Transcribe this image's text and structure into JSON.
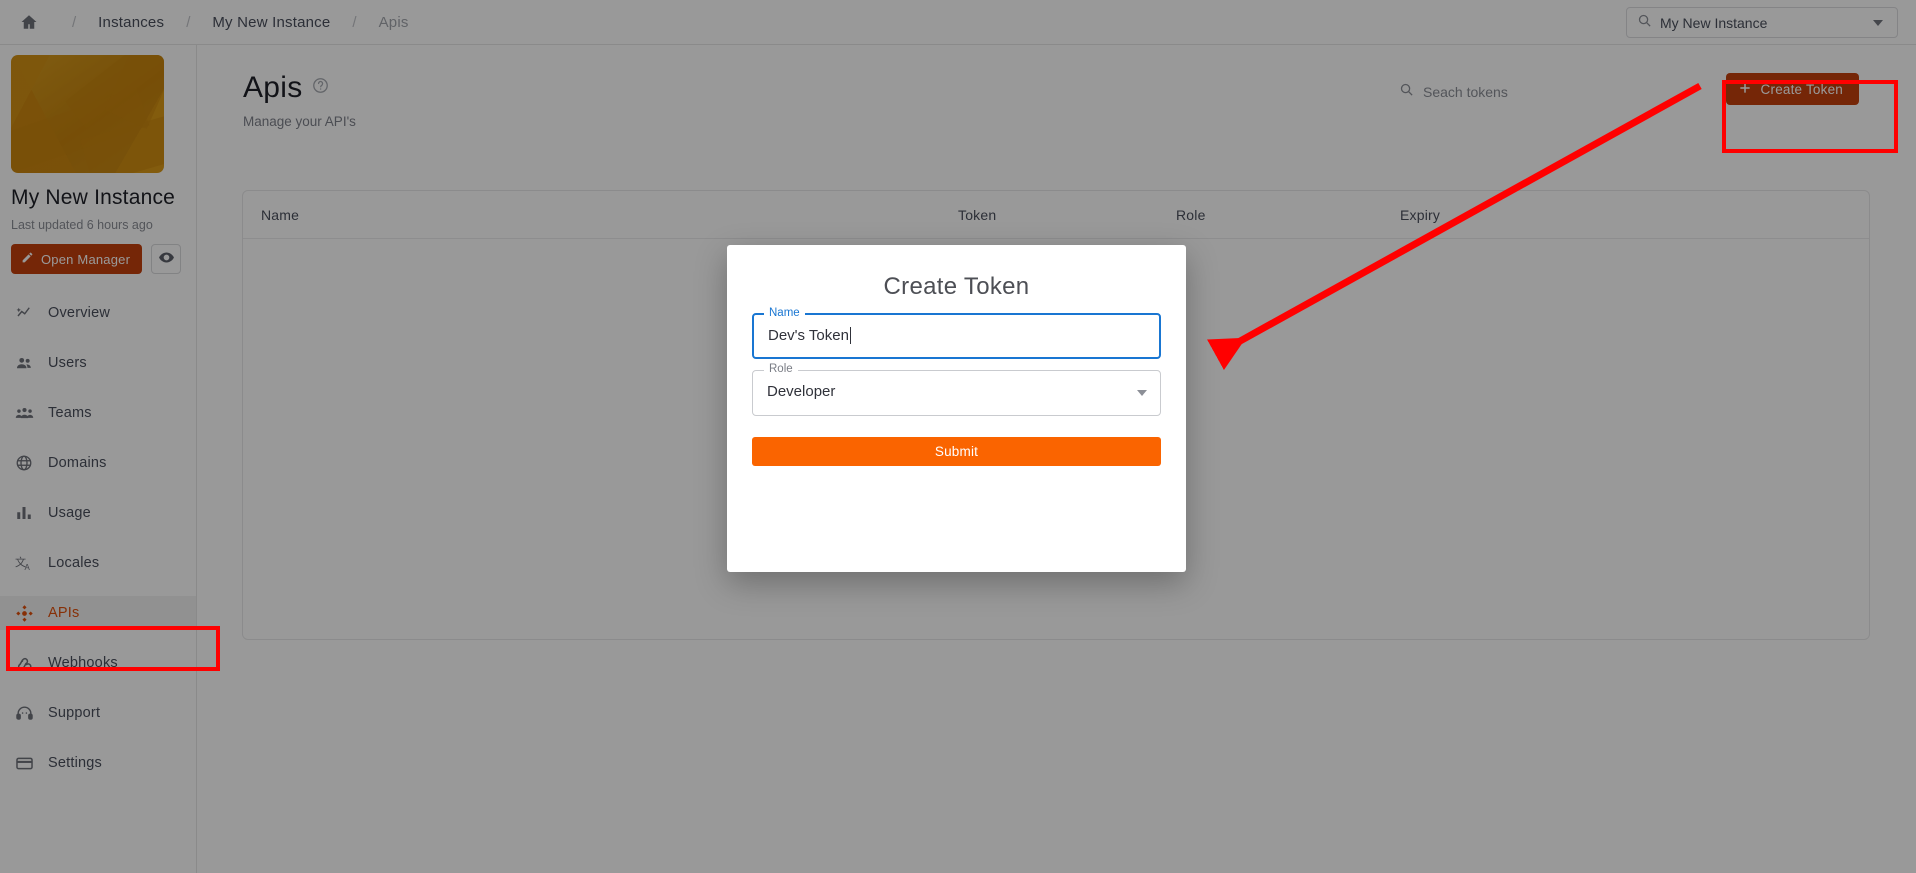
{
  "topbar": {
    "home_icon": "home-icon",
    "breadcrumbs": [
      {
        "label": "Instances",
        "muted": false
      },
      {
        "label": "My New Instance",
        "muted": false
      },
      {
        "label": "Apis",
        "muted": true
      }
    ],
    "separator": "/",
    "instance_select": {
      "icon": "search-icon",
      "value": "My New Instance",
      "caret": "chevron-down-icon"
    }
  },
  "sidebar": {
    "instance": {
      "thumbnail_alt": "instance-thumbnail",
      "name": "My New Instance",
      "updated": "Last updated 6 hours ago",
      "open_manager_label": "Open Manager",
      "open_manager_icon": "pencil-icon",
      "preview_icon": "eye-icon"
    },
    "items": [
      {
        "label": "Overview",
        "icon": "sparkle-chart-icon",
        "active": false
      },
      {
        "label": "Users",
        "icon": "users-icon",
        "active": false
      },
      {
        "label": "Teams",
        "icon": "teams-icon",
        "active": false
      },
      {
        "label": "Domains",
        "icon": "globe-icon",
        "active": false
      },
      {
        "label": "Usage",
        "icon": "bar-chart-icon",
        "active": false
      },
      {
        "label": "Locales",
        "icon": "translate-icon",
        "active": false
      },
      {
        "label": "APIs",
        "icon": "api-nodes-icon",
        "active": true
      },
      {
        "label": "Webhooks",
        "icon": "webhook-icon",
        "active": false
      },
      {
        "label": "Support",
        "icon": "headset-icon",
        "active": false
      },
      {
        "label": "Settings",
        "icon": "card-icon",
        "active": false
      }
    ]
  },
  "main": {
    "title": "Apis",
    "help_icon": "help-circle-icon",
    "subtitle": "Manage your API's",
    "search": {
      "icon": "search-icon",
      "placeholder": "Seach tokens"
    },
    "create_button": {
      "label": "Create Token",
      "icon": "plus-icon"
    },
    "table": {
      "columns": [
        "Name",
        "Token",
        "Role",
        "Expiry"
      ],
      "rows": []
    }
  },
  "modal": {
    "title": "Create Token",
    "name_field": {
      "legend": "Name",
      "value": "Dev's Token",
      "focused": true
    },
    "role_field": {
      "legend": "Role",
      "value": "Developer",
      "caret": "chevron-down-icon"
    },
    "submit_label": "Submit"
  },
  "annotations": {
    "highlight_color": "#ff0000",
    "boxes": [
      "create-token-button",
      "sidebar-item-apis"
    ],
    "arrow": "create-token-button-to-modal-name-field"
  },
  "colors": {
    "brand_orange": "#c4400d",
    "submit_orange": "#fa6400",
    "active_nav": "#e1510d",
    "annotation_red": "#ff0000",
    "overlay": "rgba(0,0,0,0.40)"
  }
}
